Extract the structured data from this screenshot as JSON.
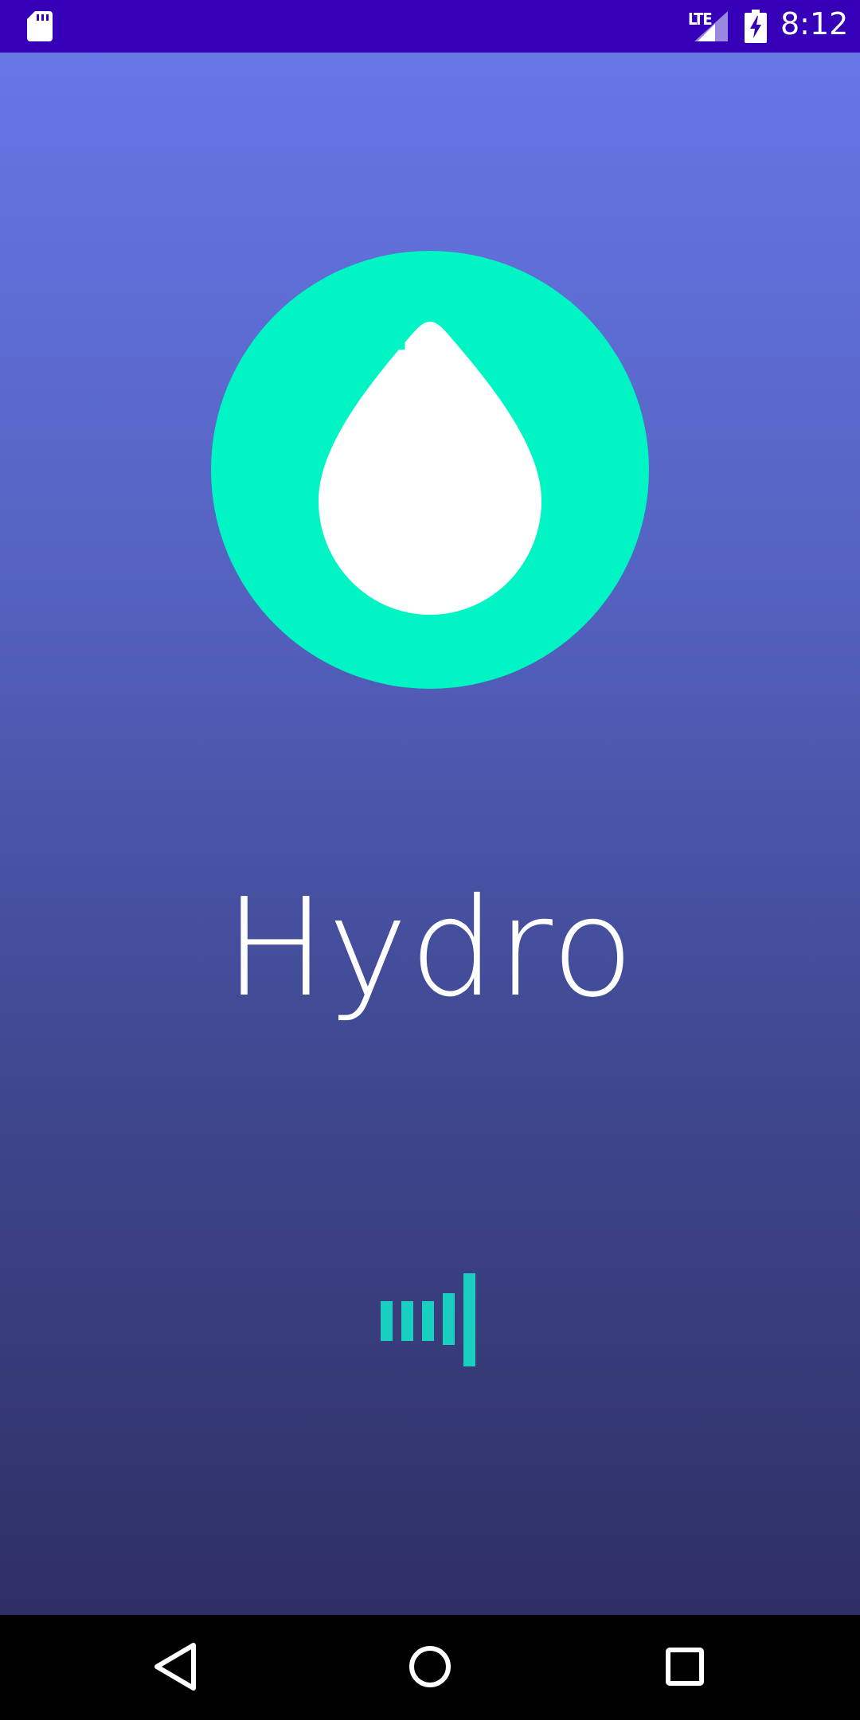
{
  "status_bar": {
    "network_label": "LTE",
    "time": "8:12",
    "color": "#3500B8",
    "icons": [
      "sd-card-icon",
      "lte-signal-icon",
      "battery-charging-icon"
    ]
  },
  "splash": {
    "app_name": "Hydro",
    "logo_icon": "water-drop-icon",
    "accent_color": "#00F4C4",
    "loader_icon": "loading-bars-icon"
  },
  "nav_bar": {
    "buttons": [
      "back-button",
      "home-button",
      "recents-button"
    ]
  }
}
